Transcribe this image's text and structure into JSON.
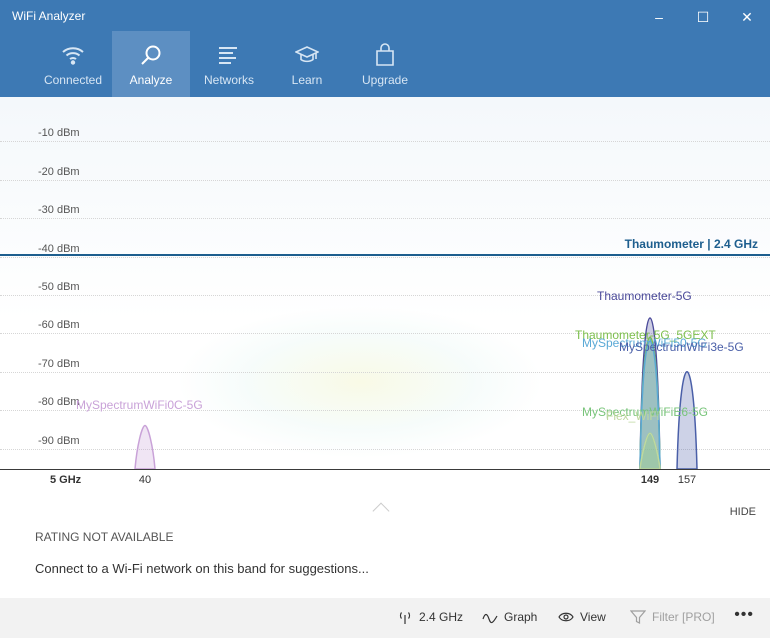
{
  "window": {
    "title": "WiFi Analyzer",
    "minimize": "–",
    "maximize": "☐",
    "close": "✕"
  },
  "nav": {
    "tabs": [
      {
        "label": "Connected",
        "icon": "wifi-icon"
      },
      {
        "label": "Analyze",
        "icon": "magnifier-icon",
        "active": true
      },
      {
        "label": "Networks",
        "icon": "list-icon"
      },
      {
        "label": "Learn",
        "icon": "graduation-cap-icon"
      },
      {
        "label": "Upgrade",
        "icon": "shopping-bag-icon"
      }
    ]
  },
  "chart_data": {
    "type": "area",
    "band": "5 GHz",
    "y_ticks": [
      "-10 dBm",
      "-20 dBm",
      "-30 dBm",
      "-40 dBm",
      "-50 dBm",
      "-60 dBm",
      "-70 dBm",
      "-80 dBm",
      "-90 dBm"
    ],
    "x_ticks": [
      "40",
      "149",
      "157"
    ],
    "connected_label": "Thaumometer | 2.4 GHz",
    "connected_level_dbm": -42,
    "series": [
      {
        "name": "MySpectrumWiFi0C-5G",
        "channel": 40,
        "dbm": -84,
        "color": "#c9a2d8"
      },
      {
        "name": "Thaumometer-5G",
        "channel": 149,
        "dbm": -56,
        "color": "#4b4a9a"
      },
      {
        "name": "Thaumometer-5G_5GEXT",
        "channel": 149,
        "dbm": -61,
        "color": "#7dbf4d"
      },
      {
        "name": "MySpectrumWiFi50-5G",
        "channel": 149,
        "dbm": -62,
        "color": "#5aa9d6"
      },
      {
        "name": "MySpectrumWiFi3e-5G",
        "channel": 157,
        "dbm": -70,
        "color": "#4a5fa8"
      },
      {
        "name": "MySpectrumWiFiE6-5G",
        "channel": 149,
        "dbm": -86,
        "color": "#78c47a"
      },
      {
        "name": "Flex_WiFi",
        "channel": 149,
        "dbm": -86,
        "color": "#bfd8a0"
      }
    ]
  },
  "panel": {
    "hide": "HIDE",
    "rating": "RATING NOT AVAILABLE",
    "suggestion": "Connect to a Wi-Fi network on this band for suggestions..."
  },
  "bottom": {
    "band": "2.4 GHz",
    "graph": "Graph",
    "view": "View",
    "filter": "Filter [PRO]",
    "more": "•••"
  }
}
